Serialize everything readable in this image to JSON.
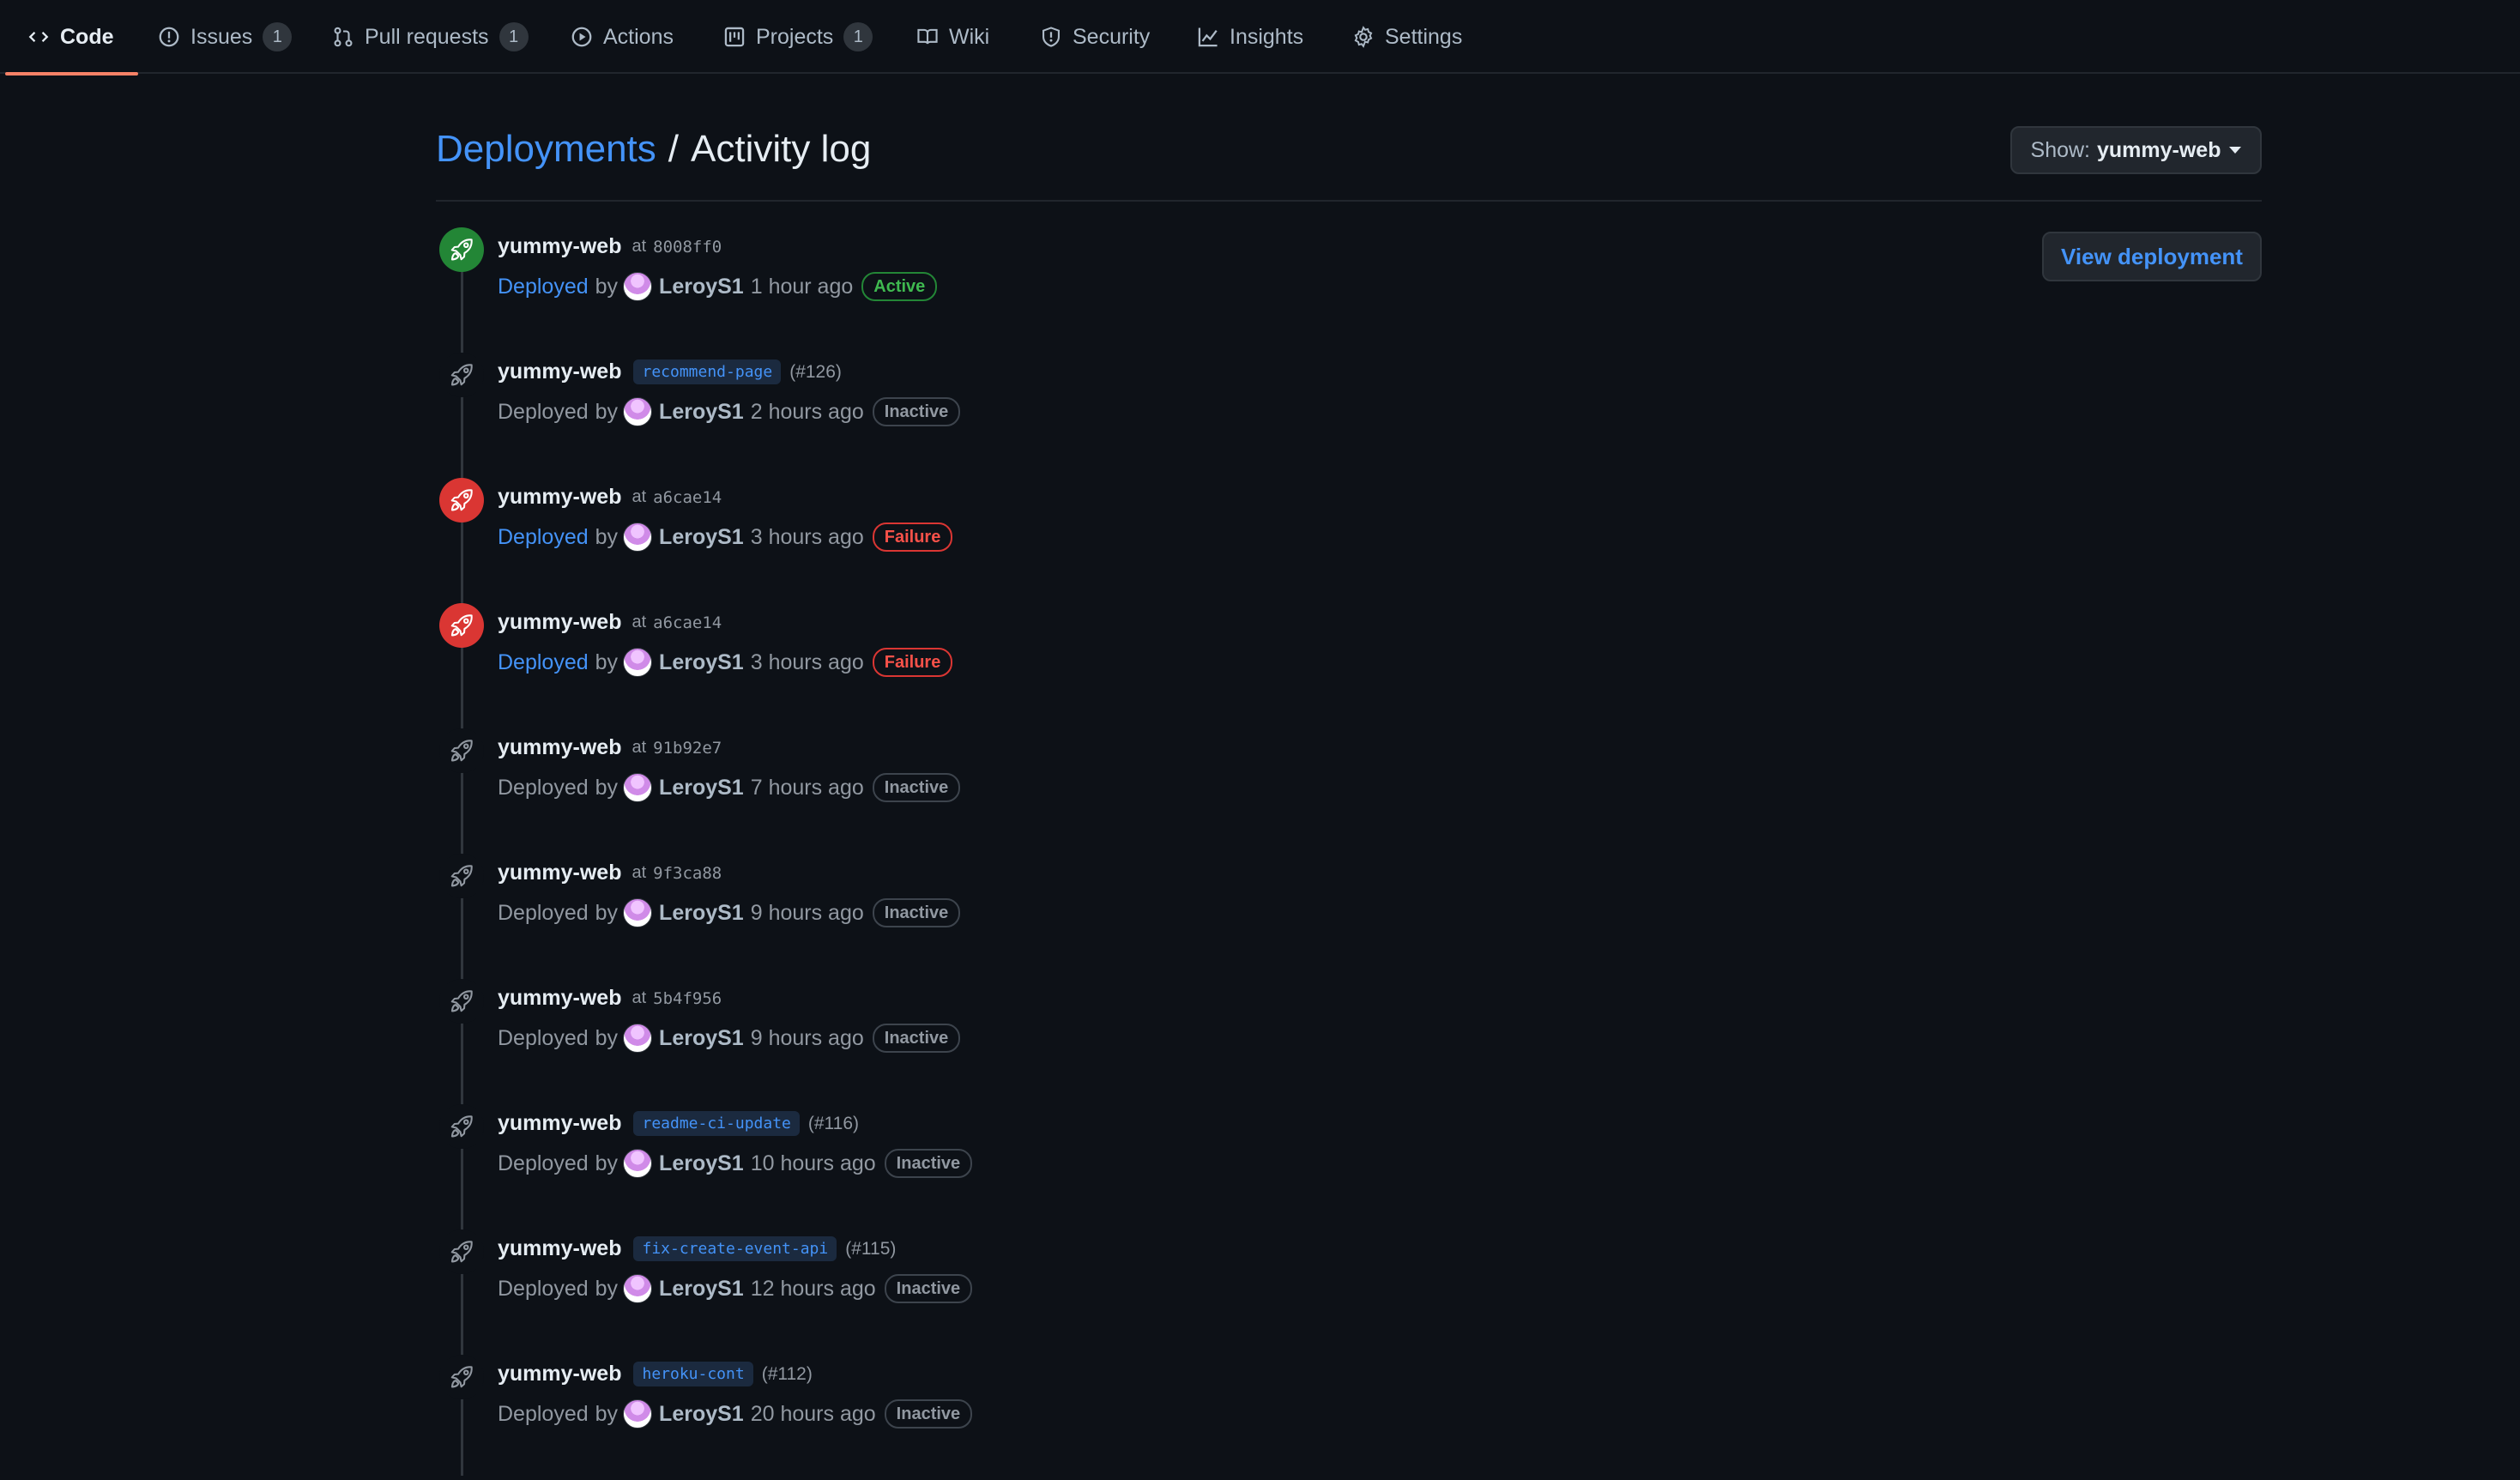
{
  "tabs": [
    {
      "label": "Code",
      "icon": "code-icon",
      "active": true
    },
    {
      "label": "Issues",
      "icon": "issue-icon",
      "count": "1"
    },
    {
      "label": "Pull requests",
      "icon": "pull-request-icon",
      "count": "1"
    },
    {
      "label": "Actions",
      "icon": "play-icon"
    },
    {
      "label": "Projects",
      "icon": "project-icon",
      "count": "1"
    },
    {
      "label": "Wiki",
      "icon": "book-icon"
    },
    {
      "label": "Security",
      "icon": "shield-icon"
    },
    {
      "label": "Insights",
      "icon": "graph-icon"
    },
    {
      "label": "Settings",
      "icon": "gear-icon"
    }
  ],
  "header": {
    "breadcrumb_link": "Deployments",
    "separator": "/",
    "title": "Activity log",
    "show_label": "Show:",
    "show_value": "yummy-web"
  },
  "view_deployment_label": "View deployment",
  "entries": [
    {
      "env": "yummy-web",
      "at": "at",
      "sha": "8008ff0",
      "branch": "",
      "pr": "",
      "deployed": "Deployed",
      "by": "by",
      "user": "LeroyS1",
      "time": "1 hour ago",
      "status": "Active",
      "state": "success"
    },
    {
      "env": "yummy-web",
      "at": "",
      "sha": "",
      "branch": "recommend-page",
      "pr": "(#126)",
      "deployed": "Deployed",
      "by": "by",
      "user": "LeroyS1",
      "time": "2 hours ago",
      "status": "Inactive",
      "state": "inactive"
    },
    {
      "env": "yummy-web",
      "at": "at",
      "sha": "a6cae14",
      "branch": "",
      "pr": "",
      "deployed": "Deployed",
      "by": "by",
      "user": "LeroyS1",
      "time": "3 hours ago",
      "status": "Failure",
      "state": "failure"
    },
    {
      "env": "yummy-web",
      "at": "at",
      "sha": "a6cae14",
      "branch": "",
      "pr": "",
      "deployed": "Deployed",
      "by": "by",
      "user": "LeroyS1",
      "time": "3 hours ago",
      "status": "Failure",
      "state": "failure"
    },
    {
      "env": "yummy-web",
      "at": "at",
      "sha": "91b92e7",
      "branch": "",
      "pr": "",
      "deployed": "Deployed",
      "by": "by",
      "user": "LeroyS1",
      "time": "7 hours ago",
      "status": "Inactive",
      "state": "inactive"
    },
    {
      "env": "yummy-web",
      "at": "at",
      "sha": "9f3ca88",
      "branch": "",
      "pr": "",
      "deployed": "Deployed",
      "by": "by",
      "user": "LeroyS1",
      "time": "9 hours ago",
      "status": "Inactive",
      "state": "inactive"
    },
    {
      "env": "yummy-web",
      "at": "at",
      "sha": "5b4f956",
      "branch": "",
      "pr": "",
      "deployed": "Deployed",
      "by": "by",
      "user": "LeroyS1",
      "time": "9 hours ago",
      "status": "Inactive",
      "state": "inactive"
    },
    {
      "env": "yummy-web",
      "at": "",
      "sha": "",
      "branch": "readme-ci-update",
      "pr": "(#116)",
      "deployed": "Deployed",
      "by": "by",
      "user": "LeroyS1",
      "time": "10 hours ago",
      "status": "Inactive",
      "state": "inactive"
    },
    {
      "env": "yummy-web",
      "at": "",
      "sha": "",
      "branch": "fix-create-event-api",
      "pr": "(#115)",
      "deployed": "Deployed",
      "by": "by",
      "user": "LeroyS1",
      "time": "12 hours ago",
      "status": "Inactive",
      "state": "inactive"
    },
    {
      "env": "yummy-web",
      "at": "",
      "sha": "",
      "branch": "heroku-cont",
      "pr": "(#112)",
      "deployed": "Deployed",
      "by": "by",
      "user": "LeroyS1",
      "time": "20 hours ago",
      "status": "Inactive",
      "state": "inactive"
    }
  ],
  "colors": {
    "background": "#0d1117",
    "link": "#4493f8",
    "success": "#238636",
    "failure": "#da3633",
    "tab_underline": "#f78166"
  }
}
